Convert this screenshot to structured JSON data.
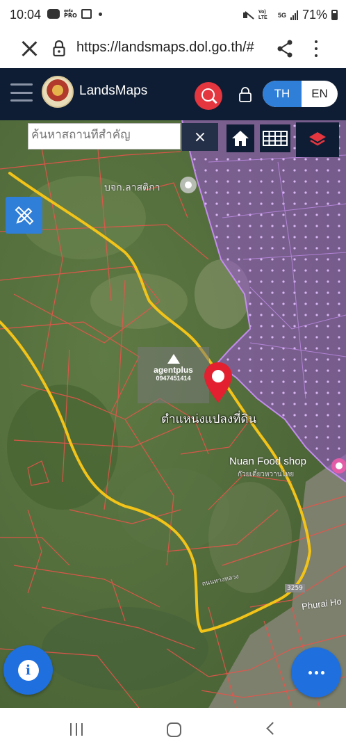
{
  "status_bar": {
    "time": "10:04",
    "pro_label_top": "สุดคุ้ม",
    "pro_label": "PRO",
    "volte": "Vo) LTE",
    "net": "5G",
    "battery": "71%"
  },
  "browser": {
    "url": "https://landsmaps.dol.go.th/#",
    "icons": [
      "close-icon",
      "lock-icon",
      "share-icon",
      "more-vert-icon"
    ]
  },
  "app_header": {
    "title": "LandsMaps",
    "lang_active": "TH",
    "lang_other": "EN",
    "colors": {
      "header_bg": "#0e1d33",
      "search_red": "#e3363f",
      "accent_blue": "#2f7ed8"
    }
  },
  "map": {
    "search_placeholder": "ค้นหาสถานที่สำคัญ",
    "clear_label": "×",
    "labels": {
      "place_bjk": "บจก.ลาสติกา",
      "parcel_position": "ตำแหน่งแปลงที่ดิน",
      "shop": "Nuan Food shop",
      "shop_th": "ก๊วยเตี๋ยวหวานไทย",
      "road": "ถนนทางหลวง",
      "highway_no": "3259",
      "road_en": "Phurai Ho"
    },
    "watermark": {
      "brand": "agentplus",
      "phone": "0947451414"
    },
    "info_label": "i",
    "colors": {
      "zone_purple": "#a05ad8",
      "parcel_lines": "#e8544b",
      "route_yellow": "#f2c318",
      "pin_red": "#e2202f"
    }
  }
}
